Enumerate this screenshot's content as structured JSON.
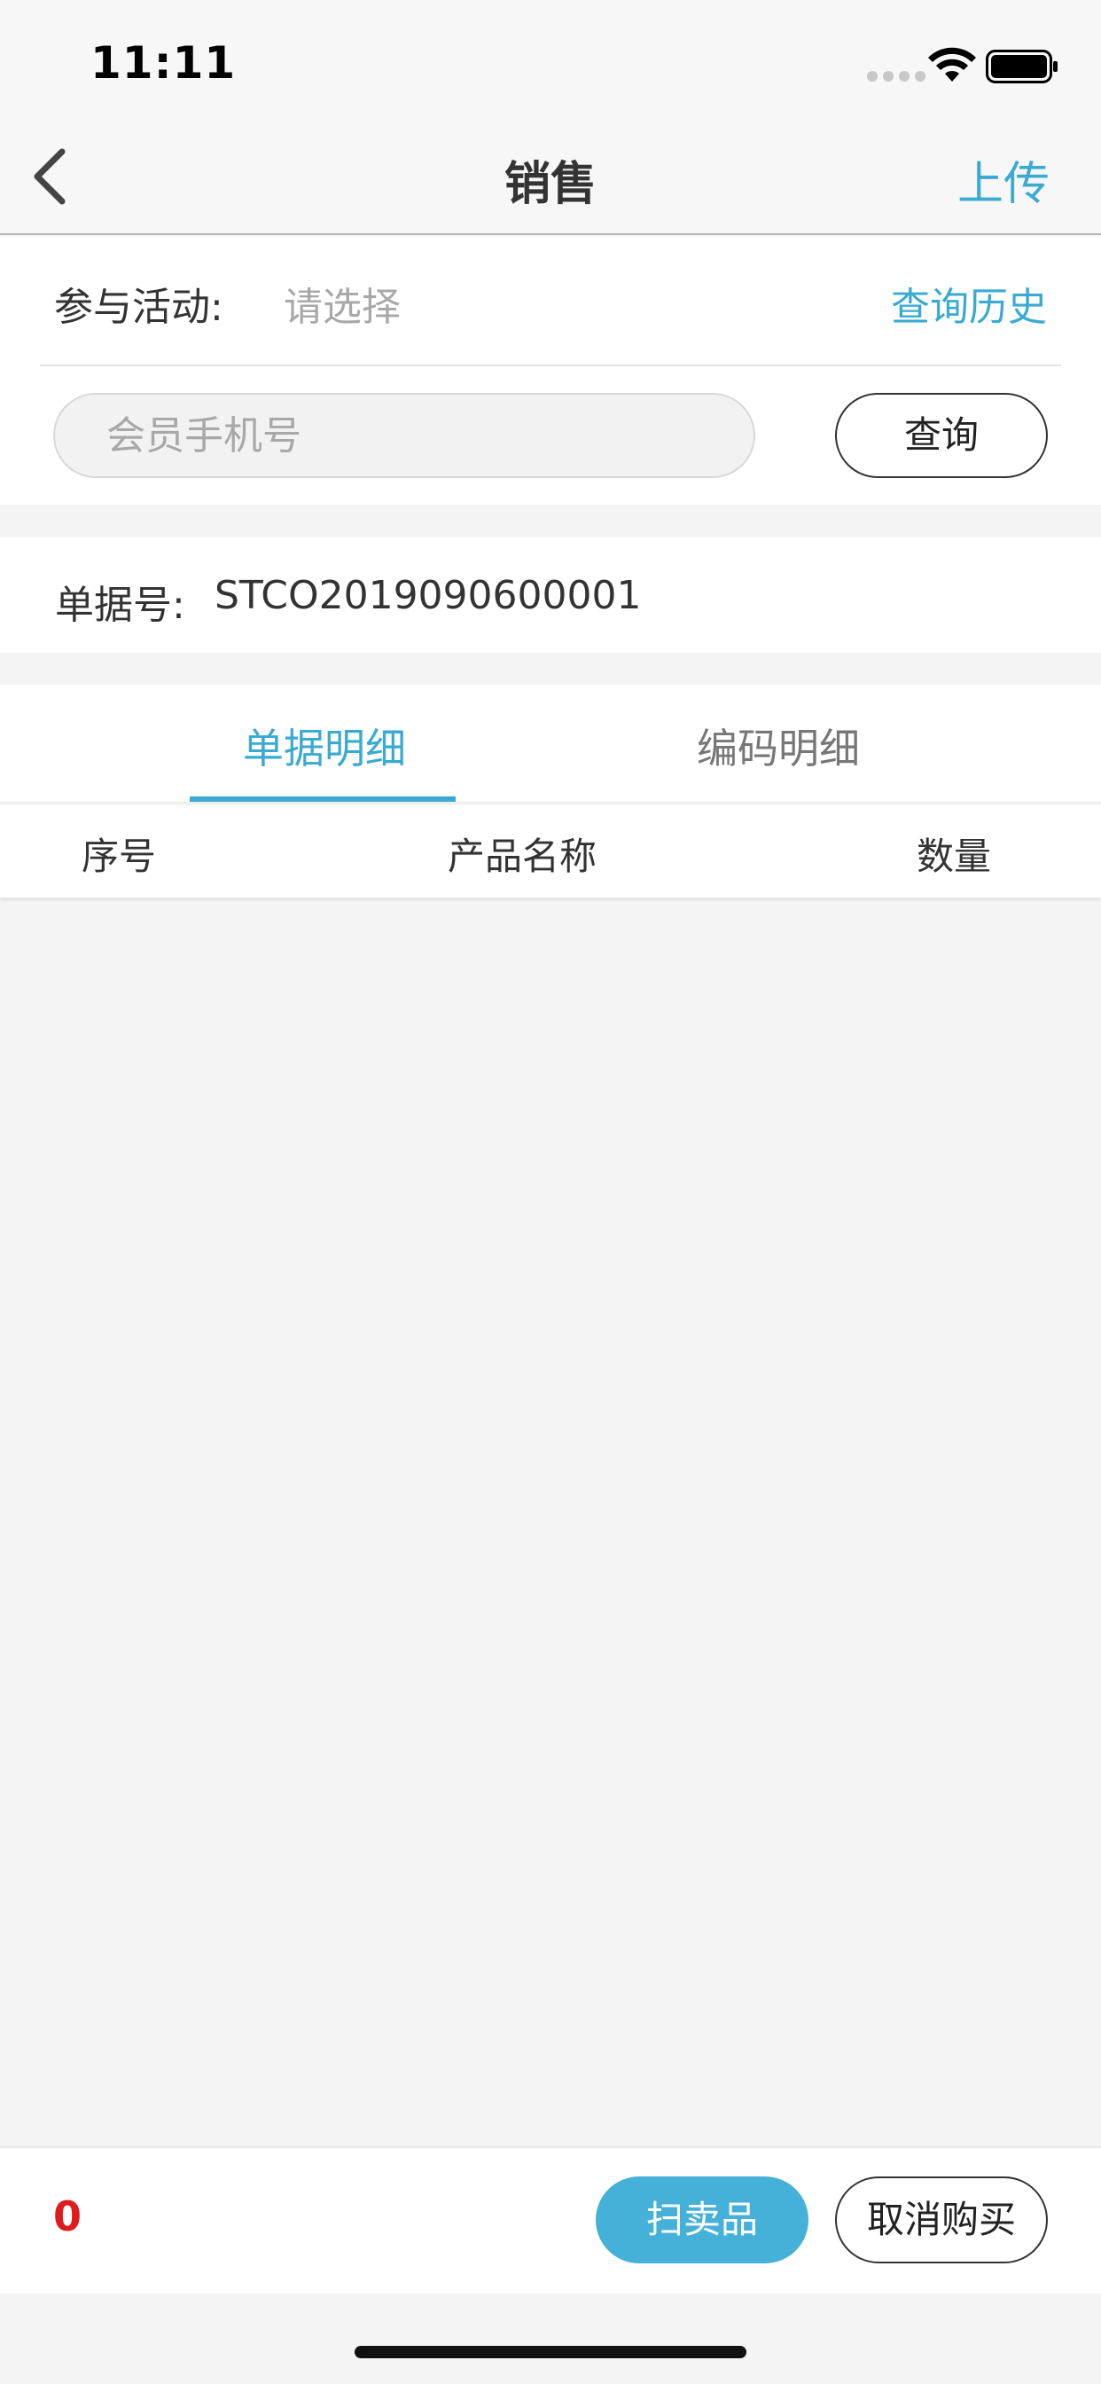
{
  "status_bar": {
    "time": "11:11",
    "icons": [
      "signal-icon",
      "wifi-icon",
      "battery-icon"
    ]
  },
  "nav": {
    "back_icon": "chevron-left-icon",
    "title": "销售",
    "upload_label": "上传"
  },
  "activity": {
    "label": "参与活动:",
    "select_placeholder": "请选择",
    "history_label": "查询历史"
  },
  "member_search": {
    "placeholder": "会员手机号",
    "value": "",
    "query_label": "查询"
  },
  "document": {
    "label": "单据号:",
    "number": "STCO2019090600001"
  },
  "tabs": [
    {
      "label": "单据明细",
      "active": true
    },
    {
      "label": "编码明细",
      "active": false
    }
  ],
  "table": {
    "columns": [
      "序号",
      "产品名称",
      "数量"
    ],
    "rows": []
  },
  "bottom_bar": {
    "count": "0",
    "scan_label": "扫卖品",
    "cancel_label": "取消购买"
  },
  "colors": {
    "accent": "#3aaad2",
    "count_red": "#e01b1b",
    "background": "#f4f4f4"
  }
}
